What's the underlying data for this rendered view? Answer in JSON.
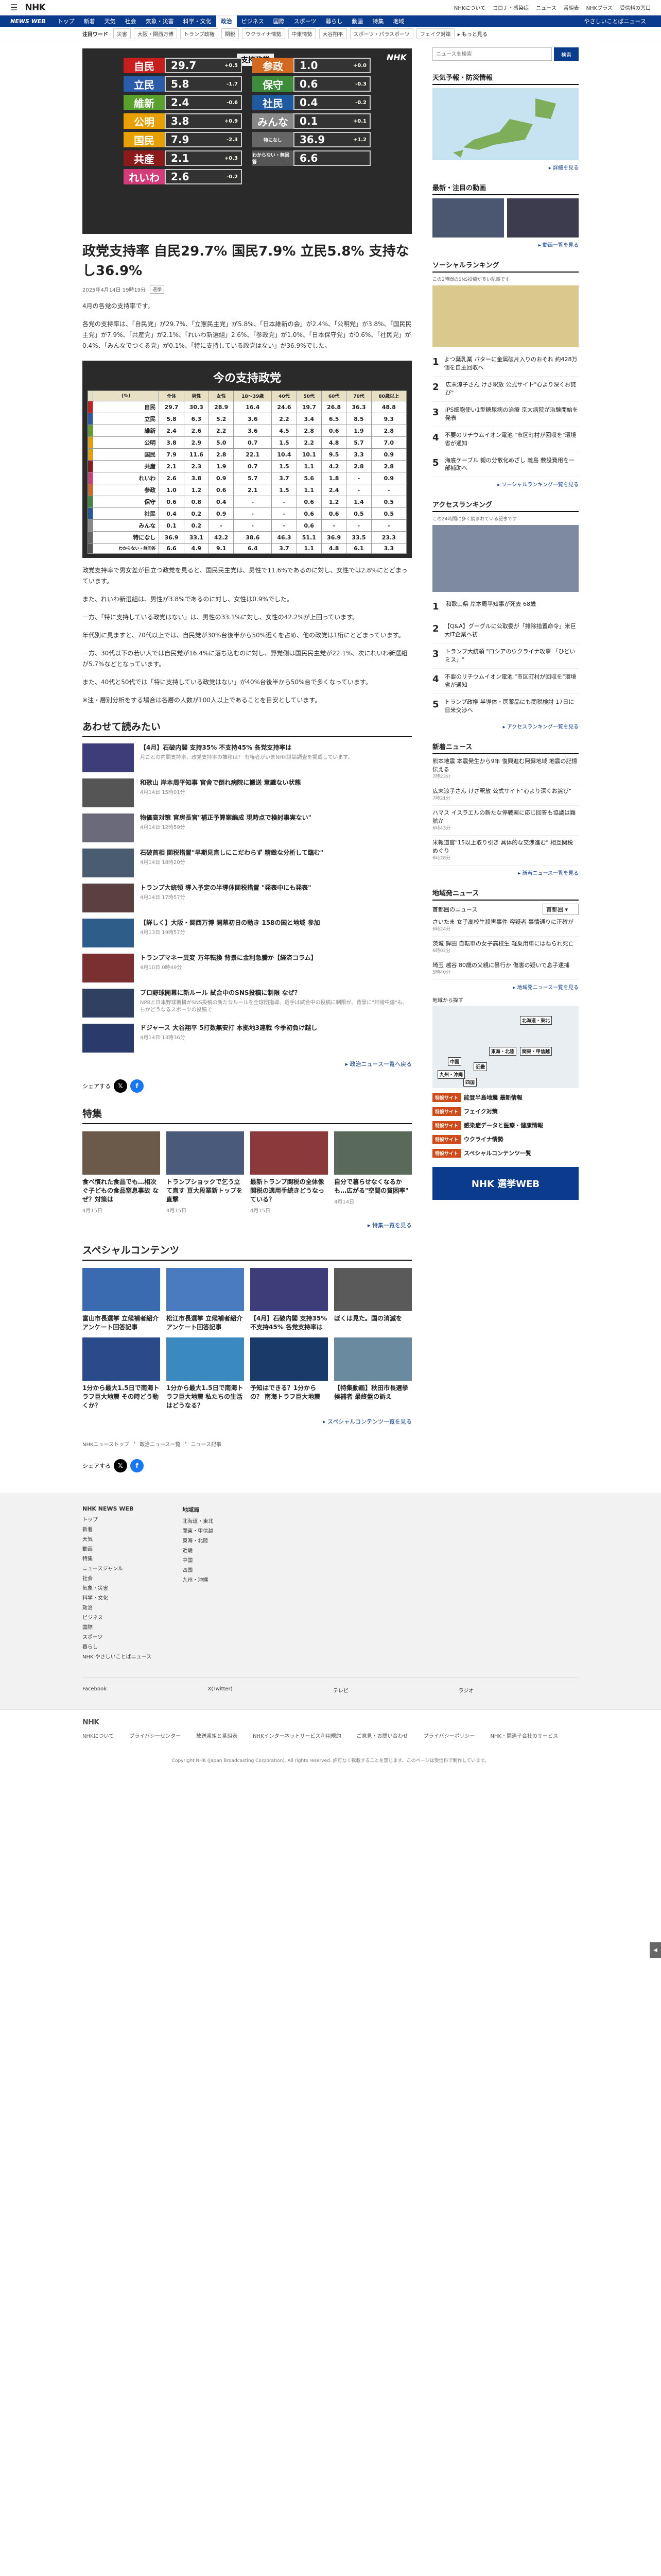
{
  "header": {
    "logo": "NHK",
    "links": [
      "NHKについて",
      "コロナ・感染症",
      "ニュース",
      "番組表",
      "NHKプラス",
      "受信料の窓口"
    ]
  },
  "nav": {
    "brand": "NEWS WEB",
    "items": [
      "トップ",
      "新着",
      "天気",
      "社会",
      "気象・災害",
      "科学・文化",
      "政治",
      "ビジネス",
      "国際",
      "スポーツ",
      "暮らし",
      "動画",
      "特集",
      "地域"
    ],
    "active": "政治",
    "right": [
      "やさしいことばニュース"
    ]
  },
  "keywords": {
    "label": "注目ワード",
    "items": [
      "災害",
      "大阪・関西万博",
      "トランプ政権",
      "関税",
      "ウクライナ情勢",
      "中東情勢",
      "大谷翔平",
      "スポーツ・パラスポーツ",
      "フェイク対策"
    ],
    "more": "もっと見る"
  },
  "hero": {
    "badge": "支持政党",
    "watermark": "NHK",
    "rows": [
      {
        "party": "自民",
        "value": "29.7",
        "delta": "+0.5",
        "color": "#c81e1e"
      },
      {
        "party": "参政",
        "value": "1.0",
        "delta": "+0.0",
        "color": "#d2691e"
      },
      {
        "party": "立民",
        "value": "5.8",
        "delta": "-1.7",
        "color": "#2a5caa"
      },
      {
        "party": "保守",
        "value": "0.6",
        "delta": "-0.3",
        "color": "#3c8c3c"
      },
      {
        "party": "維新",
        "value": "2.4",
        "delta": "-0.6",
        "color": "#5aa02c"
      },
      {
        "party": "社民",
        "value": "0.4",
        "delta": "-0.2",
        "color": "#1e5aa0"
      },
      {
        "party": "公明",
        "value": "3.8",
        "delta": "+0.9",
        "color": "#e8a000"
      },
      {
        "party": "みんな",
        "value": "0.1",
        "delta": "+0.1",
        "color": "#888888"
      },
      {
        "party": "国民",
        "value": "7.9",
        "delta": "-2.3",
        "color": "#e6a000"
      },
      {
        "party": "特になし",
        "value": "36.9",
        "delta": "+1.2",
        "color": "#666666"
      },
      {
        "party": "共産",
        "value": "2.1",
        "delta": "+0.3",
        "color": "#8b1a1a"
      },
      {
        "party": "わからない・無回答",
        "value": "6.6",
        "delta": "",
        "color": "#555555"
      },
      {
        "party": "れいわ",
        "value": "2.6",
        "delta": "-0.2",
        "color": "#d23c78"
      }
    ]
  },
  "article": {
    "title": "政党支持率 自民29.7% 国民7.9% 立民5.8% 支持なし36.9%",
    "date": "2025年4月14日 19時19分",
    "tag": "選挙",
    "lead": "4月の各党の支持率です。",
    "p1": "各党の支持率は、「自民党」が29.7%、「立憲民主党」が5.8%、「日本維新の会」が2.4%、「公明党」が3.8%、「国民民主党」が7.9%、「共産党」が2.1%、「れいわ新選組」2.6%、「参政党」が1.0%、「日本保守党」が0.6%、「社民党」が0.4%、「みんなでつくる党」が0.1%、「特に支持している政党はない」が36.9%でした。",
    "p2": "政党支持率で男女差が目立つ政党を見ると、国民民主党は、男性で11.6%であるのに対し、女性では2.8%にとどまっています。",
    "p3": "また、れいわ新選組は、男性が3.8%であるのに対し、女性は0.9%でした。",
    "p4": "一方、「特に支持している政党はない」は、男性の33.1%に対し、女性の42.2%が上回っています。",
    "p5": "年代別に見ますと、70代以上では、自民党が30%台後半から50%近くを占め、他の政党は1桁にとどまっています。",
    "p6": "一方、30代以下の若い人では自民党が16.4%に落ち込むのに対し、野党側は国民民主党が22.1%、次にれいわ新選組が5.7%などとなっています。",
    "p7": "また、40代と50代では「特に支持している政党はない」が40%台後半から50%台で多くなっています。",
    "note": "※注・層別分析をする場合は各層の人数が100人以上であることを目安としています。"
  },
  "poll_table": {
    "title": "今の支持政党",
    "watermark": "NHK",
    "headers": [
      "(%)",
      "全体",
      "男性",
      "女性",
      "18〜39歳",
      "40代",
      "50代",
      "60代",
      "70代",
      "80歳以上"
    ],
    "rows": [
      {
        "party": "自民",
        "color": "#c81e1e",
        "vals": [
          "29.7",
          "30.3",
          "28.9",
          "16.4",
          "24.6",
          "19.7",
          "26.8",
          "36.3",
          "48.8"
        ]
      },
      {
        "party": "立民",
        "color": "#2a5caa",
        "vals": [
          "5.8",
          "6.3",
          "5.2",
          "3.6",
          "2.2",
          "3.4",
          "6.5",
          "8.5",
          "9.3"
        ]
      },
      {
        "party": "維新",
        "color": "#5aa02c",
        "vals": [
          "2.4",
          "2.6",
          "2.2",
          "3.6",
          "4.5",
          "2.8",
          "0.6",
          "1.9",
          "2.8"
        ]
      },
      {
        "party": "公明",
        "color": "#e8a000",
        "vals": [
          "3.8",
          "2.9",
          "5.0",
          "0.7",
          "1.5",
          "2.2",
          "4.8",
          "5.7",
          "7.0"
        ]
      },
      {
        "party": "国民",
        "color": "#e6a000",
        "vals": [
          "7.9",
          "11.6",
          "2.8",
          "22.1",
          "10.4",
          "10.1",
          "9.5",
          "3.3",
          "0.9"
        ]
      },
      {
        "party": "共産",
        "color": "#8b1a1a",
        "vals": [
          "2.1",
          "2.3",
          "1.9",
          "0.7",
          "1.5",
          "1.1",
          "4.2",
          "2.8",
          "2.8"
        ]
      },
      {
        "party": "れいわ",
        "color": "#d23c78",
        "vals": [
          "2.6",
          "3.8",
          "0.9",
          "5.7",
          "3.7",
          "5.6",
          "1.8",
          "-",
          "0.9"
        ]
      },
      {
        "party": "参政",
        "color": "#d2691e",
        "vals": [
          "1.0",
          "1.2",
          "0.6",
          "2.1",
          "1.5",
          "1.1",
          "2.4",
          "-",
          "-"
        ]
      },
      {
        "party": "保守",
        "color": "#3c8c3c",
        "vals": [
          "0.6",
          "0.8",
          "0.4",
          "-",
          "-",
          "0.6",
          "1.2",
          "1.4",
          "0.5"
        ]
      },
      {
        "party": "社民",
        "color": "#1e5aa0",
        "vals": [
          "0.4",
          "0.2",
          "0.9",
          "-",
          "-",
          "0.6",
          "0.6",
          "0.5",
          "0.5"
        ]
      },
      {
        "party": "みんな",
        "color": "#888888",
        "vals": [
          "0.1",
          "0.2",
          "-",
          "-",
          "-",
          "0.6",
          "-",
          "-",
          "-"
        ]
      },
      {
        "party": "特になし",
        "color": "#666666",
        "vals": [
          "36.9",
          "33.1",
          "42.2",
          "38.6",
          "46.3",
          "51.1",
          "36.9",
          "33.5",
          "23.3"
        ]
      },
      {
        "party": "わからない・無回答",
        "color": "#555555",
        "vals": [
          "6.6",
          "4.9",
          "9.1",
          "6.4",
          "3.7",
          "1.1",
          "4.8",
          "6.1",
          "3.3"
        ]
      }
    ]
  },
  "related": {
    "title": "あわせて読みたい",
    "items": [
      {
        "t": "【4月】石破内閣 支持35% 不支持45% 各党支持率は",
        "s": "月ごとの内閣支持率、政党支持率の推移は？ 有権者がいまNHK世論調査を掲載しています。",
        "d": ""
      },
      {
        "t": "和歌山 岸本周平知事 官舎で倒れ病院に搬送 意識ない状態",
        "s": "",
        "d": "4月14日 15時01分"
      },
      {
        "t": "物価高対策 官房長官\"補正予算案編成 現時点で検討事実ない\"",
        "s": "",
        "d": "4月14日 12時59分"
      },
      {
        "t": "石破首相 関税措置\"早期見直しにこだわらず 精緻な分析して臨む\"",
        "s": "",
        "d": "4月14日 18時20分"
      },
      {
        "t": "トランプ大統領 導入予定の半導体関税措置 \"発表中にも発表\"",
        "s": "",
        "d": "4月14日 17時57分"
      },
      {
        "t": "【詳しく】大阪・関西万博 開幕初日の動き 158の国と地域 参加",
        "s": "",
        "d": "4月13日 19時57分"
      },
      {
        "t": "トランプマネー異変 万年転換 背景に金利急騰か【経済コラム】",
        "s": "",
        "d": "4月10日 0時49分"
      },
      {
        "t": "プロ野球開幕に新ルール 試合中のSNS投稿に制限 なぜ？",
        "s": "NPBと日本野球機構がSNS投稿の新たなルールを全球団指導。選手は試合中の投稿に制限が。背景に\"誹謗中傷\"も、ちかどうなるスポーツの投稿で",
        "d": ""
      },
      {
        "t": "ドジャース 大谷翔平 5打数無安打 本拠地3連戦 今季初負け越し",
        "s": "",
        "d": "4月14日 13時36分"
      }
    ],
    "more": "政治ニュース一覧へ戻る"
  },
  "share": {
    "label": "シェアする"
  },
  "features": {
    "title": "特集",
    "items": [
      {
        "t": "食べ慣れた食品でも…相次ぐ子どもの食品窒息事故 なぜ？対策は",
        "d": "4月15日"
      },
      {
        "t": "トランプショックで乞う立て直す 豆大段業新トップを直撃",
        "d": "4月15日"
      },
      {
        "t": "最新トランプ関税の全体像 関税の適用手続きどうなっている？",
        "d": "4月15日"
      },
      {
        "t": "自分で暮らせなくなるかも…広がる\"空間の貧困率\"",
        "d": "4月14日"
      }
    ],
    "more": "特集一覧を見る"
  },
  "special": {
    "title": "スペシャルコンテンツ",
    "items": [
      {
        "t": "富山市長選挙 立候補者紹介 アンケート回答記事",
        "d": ""
      },
      {
        "t": "松江市長選挙 立候補者紹介 アンケート回答記事",
        "d": ""
      },
      {
        "t": "【4月】石破内閣 支持35% 不支持45% 各党支持率は",
        "d": ""
      },
      {
        "t": "ぼくは見た。国の消滅を",
        "d": ""
      },
      {
        "t": "1分から最大1.5日で南海トラフ巨大地震 その時どう動くか？",
        "d": ""
      },
      {
        "t": "1分から最大1.5日で南海トラフ巨大地震 私たちの生活はどうなる？",
        "d": ""
      },
      {
        "t": "予知はできる？1分からの？ 南海トラフ巨大地震",
        "d": ""
      },
      {
        "t": "【特集動画】秋田市長選挙 候補者 最終盤の訴え",
        "d": ""
      }
    ],
    "more": "スペシャルコンテンツ一覧を見る"
  },
  "breadcrumb": [
    "NHKニューストップ",
    "政治ニュース一覧",
    "ニュース記事"
  ],
  "sidebar": {
    "search_placeholder": "ニュースを検索",
    "search_button": "検索",
    "weather": {
      "title": "天気予報・防災情報",
      "more": "詳細を見る"
    },
    "video": {
      "title": "最新・注目の動画",
      "more": "動画一覧を見る"
    },
    "social": {
      "title": "ソーシャルランキング",
      "sub": "この2時間のSNS投稿が多い記事です",
      "items": [
        "よつ葉乳業 バターに金属破片入りのおそれ 約428万個を自主回収へ",
        "広末涼子さん けさ釈放 公式サイト\"心より深くお詫び\"",
        "iPS細胞使い1型糖尿病の治療 京大病院が治験開始を発表",
        "不要のリチウムイオン電池 \"市区町村が回収を\"環境省が通知",
        "海底ケーブル 親の分散化めざし 離島 敷設費用を一部補助へ"
      ],
      "more": "ソーシャルランキング一覧を見る"
    },
    "access": {
      "title": "アクセスランキング",
      "sub": "この24時間に多く読まれている記事です",
      "items": [
        "和歌山県 岸本周平知事が死去 68歳",
        "【Q&A】グーグルに公取委が「排除措置命令」米巨大IT企業へ初",
        "トランプ大統領 \"ロシアのウクライナ攻撃 「ひどいミス」\"",
        "不要のリチウムイオン電池 \"市区町村が回収を\"環境省が通知",
        "トランプ政権 半導体・医薬品にも関税検討 17日に日米交渉へ"
      ],
      "more": "アクセスランキング一覧を見る"
    },
    "newest": {
      "title": "新着ニュース",
      "items": [
        {
          "t": "熊本地震 本震発生から9年 復興進む阿蘇地域 地震の記憶伝える",
          "d": "7時23分"
        },
        {
          "t": "広末涼子さん けさ釈放 公式サイト\"心より深くお詫び\"",
          "d": "7時21分"
        },
        {
          "t": "ハマス イスラエルの新たな停戦案に応じ回答も協議は難航か",
          "d": "6時43分"
        },
        {
          "t": "米報道官\"15以上取り引き 具体的な交渉進む\" 相互関税めぐり",
          "d": "6時28分"
        }
      ],
      "more": "新着ニュース一覧を見る"
    },
    "regional": {
      "title": "地域発ニュース",
      "select_label": "首都圏のニュース",
      "select_value": "首都圏",
      "items": [
        {
          "t": "さいたま 女子高校生殺害事件 容疑者 事情通りに正確が",
          "d": "6時24分"
        },
        {
          "t": "茨城 鉾田 自転車の女子高校生 軽乗用車にはねられ死亡",
          "d": "6時02分"
        },
        {
          "t": "埼玉 越谷 80歳の父親に暴行か 傷害の疑いで息子逮捕",
          "d": "5時40分"
        }
      ],
      "more": "地域発ニュース一覧を見る",
      "map_label": "地域から探す",
      "regions": [
        "北海道・東北",
        "関東・甲信越",
        "東海・北陸",
        "近畿",
        "中国",
        "四国",
        "九州・沖縄"
      ]
    },
    "pills": [
      {
        "b": "特設サイト",
        "t": "能登半島地震 最新情報"
      },
      {
        "b": "特設サイト",
        "t": "フェイク対策"
      },
      {
        "b": "特設サイト",
        "t": "感染症データと医療・健康情報"
      },
      {
        "b": "特設サイト",
        "t": "ウクライナ情勢"
      },
      {
        "b": "特設サイト",
        "t": "スペシャルコンテンツ一覧"
      }
    ],
    "banner": "NHK 選挙WEB"
  },
  "footer": {
    "left_title": "NHK NEWS WEB",
    "left_items": [
      "トップ",
      "新着",
      "天気",
      "動画",
      "特集",
      "ニュースジャンル",
      "社会",
      "気象・災害",
      "科学・文化",
      "政治",
      "ビジネス",
      "国際",
      "スポーツ",
      "暮らし",
      "NHK やさしいことばニュース"
    ],
    "region_title": "地域局",
    "regions": [
      "北海道・東北",
      "関東・甲信越",
      "東海・北陸",
      "近畿",
      "中国",
      "四国",
      "九州・沖縄"
    ],
    "sns": [
      "Facebook",
      "X(Twitter)",
      "テレビ",
      "ラジオ"
    ],
    "bottom_links": [
      "NHKについて",
      "プライバシーセンター",
      "放送番組と番組表",
      "NHKインターネットサービス利用規約",
      "ご意見・お問い合わせ",
      "プライバシーポリシー",
      "NHK・関連子会社のサービス"
    ],
    "copyright": "Copyright NHK (Japan Broadcasting Corporation). All rights reserved. 許可なく転載することを禁じます。このページは受信料で制作しています。"
  },
  "icons": {
    "menu": "menu-icon",
    "x": "x-icon",
    "facebook": "facebook-icon"
  }
}
